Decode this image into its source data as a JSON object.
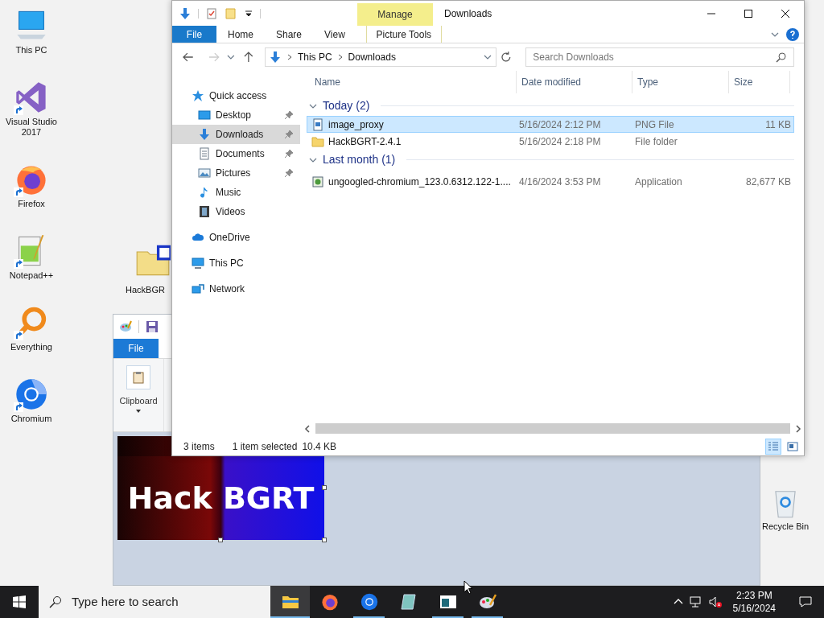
{
  "desktop_icons": [
    {
      "label": "This PC",
      "kind": "pc",
      "shortcut": false
    },
    {
      "label": "Visual Studio 2017",
      "kind": "vs",
      "shortcut": true
    },
    {
      "label": "Firefox",
      "kind": "firefox",
      "shortcut": true
    },
    {
      "label": "Notepad++",
      "kind": "notepad",
      "shortcut": true
    },
    {
      "label": "Everything",
      "kind": "everything",
      "shortcut": true
    },
    {
      "label": "Chromium",
      "kind": "chromium",
      "shortcut": true
    },
    {
      "label": "HackBGR",
      "kind": "zip",
      "shortcut": false
    },
    {
      "label": "Recycle Bin",
      "kind": "bin",
      "shortcut": false
    }
  ],
  "paint": {
    "file_tab": "File",
    "group": "Clipboard",
    "image_text": "Hack BGRT"
  },
  "explorer": {
    "title": "Downloads",
    "context_tab": "Manage",
    "ribbon_tabs": [
      {
        "label": "File",
        "kind": "file"
      },
      {
        "label": "Home",
        "kind": "tab"
      },
      {
        "label": "Share",
        "kind": "tab"
      },
      {
        "label": "View",
        "kind": "tab"
      },
      {
        "label": "Picture Tools",
        "kind": "context"
      }
    ],
    "path": [
      "This PC",
      "Downloads"
    ],
    "search": {
      "placeholder": "Search Downloads"
    },
    "nav": [
      {
        "label": "Quick access",
        "kind": "star",
        "pinned": false,
        "selected": false,
        "children": [
          {
            "label": "Desktop",
            "kind": "desktop",
            "pinned": true,
            "selected": false
          },
          {
            "label": "Downloads",
            "kind": "download",
            "pinned": true,
            "selected": true
          },
          {
            "label": "Documents",
            "kind": "document",
            "pinned": true,
            "selected": false
          },
          {
            "label": "Pictures",
            "kind": "pictures",
            "pinned": true,
            "selected": false
          },
          {
            "label": "Music",
            "kind": "music",
            "pinned": false,
            "selected": false
          },
          {
            "label": "Videos",
            "kind": "videos",
            "pinned": false,
            "selected": false
          }
        ]
      },
      {
        "label": "OneDrive",
        "kind": "cloud",
        "pinned": false,
        "selected": false
      },
      {
        "label": "This PC",
        "kind": "pc",
        "pinned": false,
        "selected": false
      },
      {
        "label": "Network",
        "kind": "network",
        "pinned": false,
        "selected": false
      }
    ],
    "columns": [
      "Name",
      "Date modified",
      "Type",
      "Size"
    ],
    "groups": [
      {
        "title": "Today (2)",
        "expanded": true,
        "rows": [
          {
            "name": "image_proxy",
            "date": "5/16/2024 2:12 PM",
            "type": "PNG File",
            "size": "11 KB",
            "kind": "png",
            "selected": true
          },
          {
            "name": "HackBGRT-2.4.1",
            "date": "5/16/2024 2:18 PM",
            "type": "File folder",
            "size": "",
            "kind": "folder",
            "selected": false
          }
        ]
      },
      {
        "title": "Last month (1)",
        "expanded": true,
        "rows": [
          {
            "name": "ungoogled-chromium_123.0.6312.122-1....",
            "date": "4/16/2024 3:53 PM",
            "type": "Application",
            "size": "82,677 KB",
            "kind": "app",
            "selected": false
          }
        ]
      }
    ],
    "status": {
      "count": "3 items",
      "selection": "1 item selected",
      "size": "10.4 KB"
    },
    "views": [
      {
        "kind": "details",
        "selected": true
      },
      {
        "kind": "tiles",
        "selected": false
      }
    ]
  },
  "taskbar": {
    "search_placeholder": "Type here to search",
    "apps": [
      {
        "kind": "explorer",
        "running": true,
        "active": true
      },
      {
        "kind": "firefox",
        "running": false,
        "active": false
      },
      {
        "kind": "chromium",
        "running": true,
        "active": false
      },
      {
        "kind": "notepad",
        "running": false,
        "active": false
      },
      {
        "kind": "window",
        "running": true,
        "active": false
      },
      {
        "kind": "paint",
        "running": true,
        "active": false
      }
    ],
    "time": "2:23 PM",
    "date": "5/16/2024",
    "volume_muted": true
  }
}
